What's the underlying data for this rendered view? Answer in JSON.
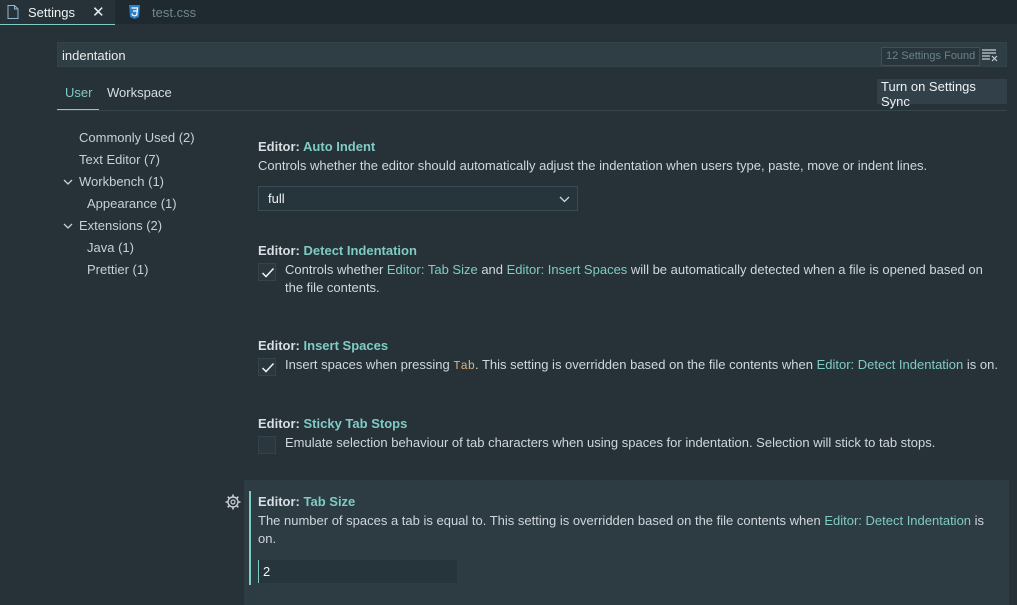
{
  "tabs": [
    {
      "label": "Settings",
      "icon": "file-icon",
      "active": true
    },
    {
      "label": "test.css",
      "icon": "css3-icon",
      "active": false
    }
  ],
  "search": {
    "value": "indentation",
    "results_badge": "12 Settings Found"
  },
  "scope_tabs": [
    {
      "label": "User",
      "active": true
    },
    {
      "label": "Workspace",
      "active": false
    }
  ],
  "sync_button": "Turn on Settings Sync",
  "toc": [
    {
      "label": "Commonly Used (2)",
      "expandable": false
    },
    {
      "label": "Text Editor (7)",
      "expandable": false
    },
    {
      "label": "Workbench (1)",
      "expandable": true
    },
    {
      "label": "Appearance (1)",
      "expandable": false
    },
    {
      "label": "Extensions (2)",
      "expandable": true
    },
    {
      "label": "Java (1)",
      "expandable": false
    },
    {
      "label": "Prettier (1)",
      "expandable": false
    }
  ],
  "settings": {
    "auto_indent": {
      "category": "Editor:",
      "name": "Auto Indent",
      "description": "Controls whether the editor should automatically adjust the indentation when users type, paste, move or indent lines.",
      "value": "full"
    },
    "detect_indentation": {
      "category": "Editor:",
      "name": "Detect Indentation",
      "desc_parts": [
        "Controls whether ",
        "Editor: Tab Size",
        " and ",
        "Editor: Insert Spaces",
        " will be automatically detected when a file is opened based on the file contents."
      ],
      "checked": true
    },
    "insert_spaces": {
      "category": "Editor:",
      "name": "Insert Spaces",
      "desc_parts": [
        "Insert spaces when pressing ",
        "Tab",
        ". This setting is overridden based on the file contents when ",
        "Editor: Detect Indentation",
        " is on."
      ],
      "checked": true
    },
    "sticky_tab_stops": {
      "category": "Editor:",
      "name": "Sticky Tab Stops",
      "description": "Emulate selection behaviour of tab characters when using spaces for indentation. Selection will stick to tab stops.",
      "checked": false
    },
    "tab_size": {
      "category": "Editor:",
      "name": "Tab Size",
      "desc_parts": [
        "The number of spaces a tab is equal to. This setting is overridden based on the file contents when ",
        "Editor: Detect Indentation",
        " is on."
      ],
      "value": "2"
    }
  },
  "colors": {
    "accent": "#80cbc4",
    "background": "#263238",
    "code": "#ddb37a"
  },
  "icons": {
    "settings_gear": "gear-icon",
    "search_filter": "filter-icon",
    "chevron": "chevron-down-icon"
  }
}
